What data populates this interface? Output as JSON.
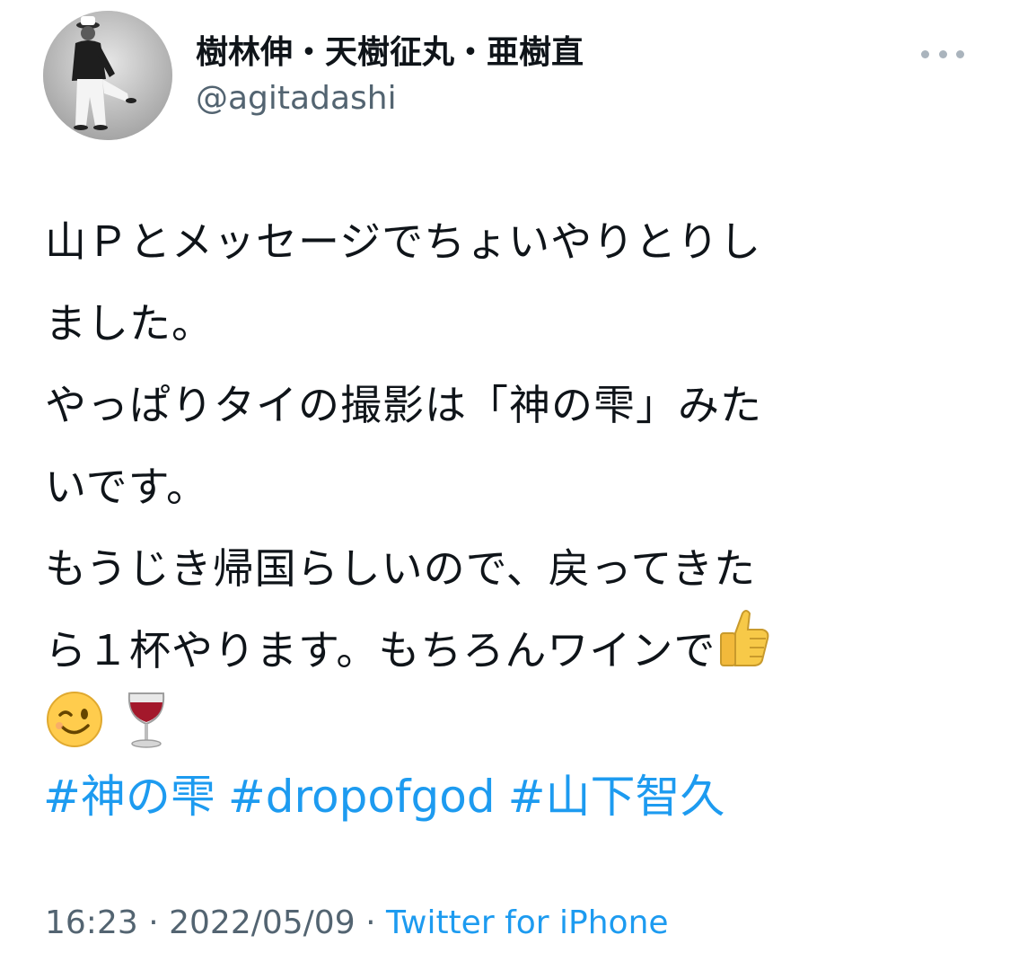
{
  "author": {
    "name": "樹林伸・天樹征丸・亜樹直",
    "handle": "@agitadashi"
  },
  "tweet": {
    "lines": [
      "山Ｐとメッセージでちょいやりとりし",
      "ました。",
      "やっぱりタイの撮影は「神の雫」みた",
      "いです。",
      "もうじき帰国らしいので、戻ってきた",
      "ら１杯やります。もちろんワインで"
    ],
    "emojis": [
      "thumbs-up-icon",
      "winking-face-icon",
      "wine-glass-icon"
    ],
    "hashtags": [
      "#神の雫",
      "#dropofgod",
      "#山下智久"
    ]
  },
  "meta": {
    "time": "16:23",
    "separator": "·",
    "date": "2022/05/09",
    "source": "Twitter for iPhone"
  },
  "colors": {
    "link": "#1d9bf0",
    "secondary_text": "#536471",
    "primary_text": "#0f1419"
  }
}
